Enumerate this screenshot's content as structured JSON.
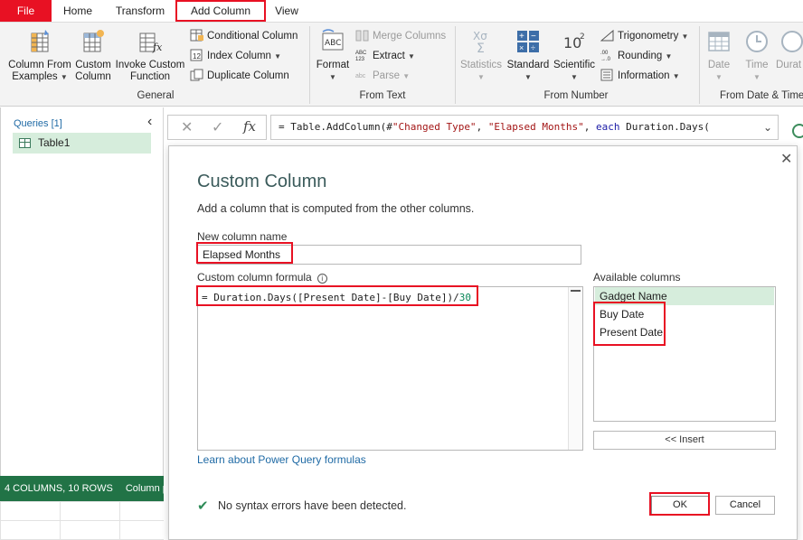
{
  "tabs": {
    "file": "File",
    "home": "Home",
    "transform": "Transform",
    "add_column": "Add Column",
    "view": "View"
  },
  "ribbon": {
    "general": {
      "column_from_examples": [
        "Column From",
        "Examples"
      ],
      "custom_column": [
        "Custom",
        "Column"
      ],
      "invoke_custom_function": [
        "Invoke Custom",
        "Function"
      ],
      "conditional_column": "Conditional Column",
      "index_column": "Index Column",
      "duplicate_column": "Duplicate Column",
      "group_label": "General"
    },
    "from_text": {
      "format": "Format",
      "merge_columns": "Merge Columns",
      "extract": "Extract",
      "parse": "Parse",
      "group_label": "From Text"
    },
    "from_number": {
      "statistics": "Statistics",
      "standard": "Standard",
      "scientific": "Scientific",
      "trigonometry": "Trigonometry",
      "rounding": "Rounding",
      "information": "Information",
      "group_label": "From Number"
    },
    "from_date_time": {
      "date": "Date",
      "time": "Time",
      "duration": "Durat",
      "group_label": "From Date & Time"
    }
  },
  "queries": {
    "label": "Queries [1]",
    "items": [
      "Table1"
    ]
  },
  "status_bar": {
    "summary": "4 COLUMNS, 10 ROWS",
    "extra": "Column pr"
  },
  "formula_bar": {
    "prefix": "= Table.AddColumn(#",
    "str1": "\"Changed Type\"",
    "comma1": ", ",
    "str2": "\"Elapsed Months\"",
    "comma2": ", ",
    "keyword": "each",
    "rest": " Duration.Days("
  },
  "dialog": {
    "title": "Custom Column",
    "description": "Add a column that is computed from the other columns.",
    "new_column_label": "New column name",
    "new_column_value": "Elapsed Months",
    "formula_label": "Custom column formula",
    "formula_main": "= Duration.Days([Present Date]-[Buy Date])/",
    "formula_num": "30",
    "available_label": "Available columns",
    "available_columns": [
      "Gadget Name",
      "Buy Date",
      "Present Date"
    ],
    "insert_label": "<< Insert",
    "learn_link": "Learn about Power Query formulas",
    "syntax_message": "No syntax errors have been detected.",
    "ok_label": "OK",
    "cancel_label": "Cancel"
  },
  "colors": {
    "accent_green": "#217346",
    "highlight_red": "#e81123",
    "selection_green": "#d6eddc"
  }
}
